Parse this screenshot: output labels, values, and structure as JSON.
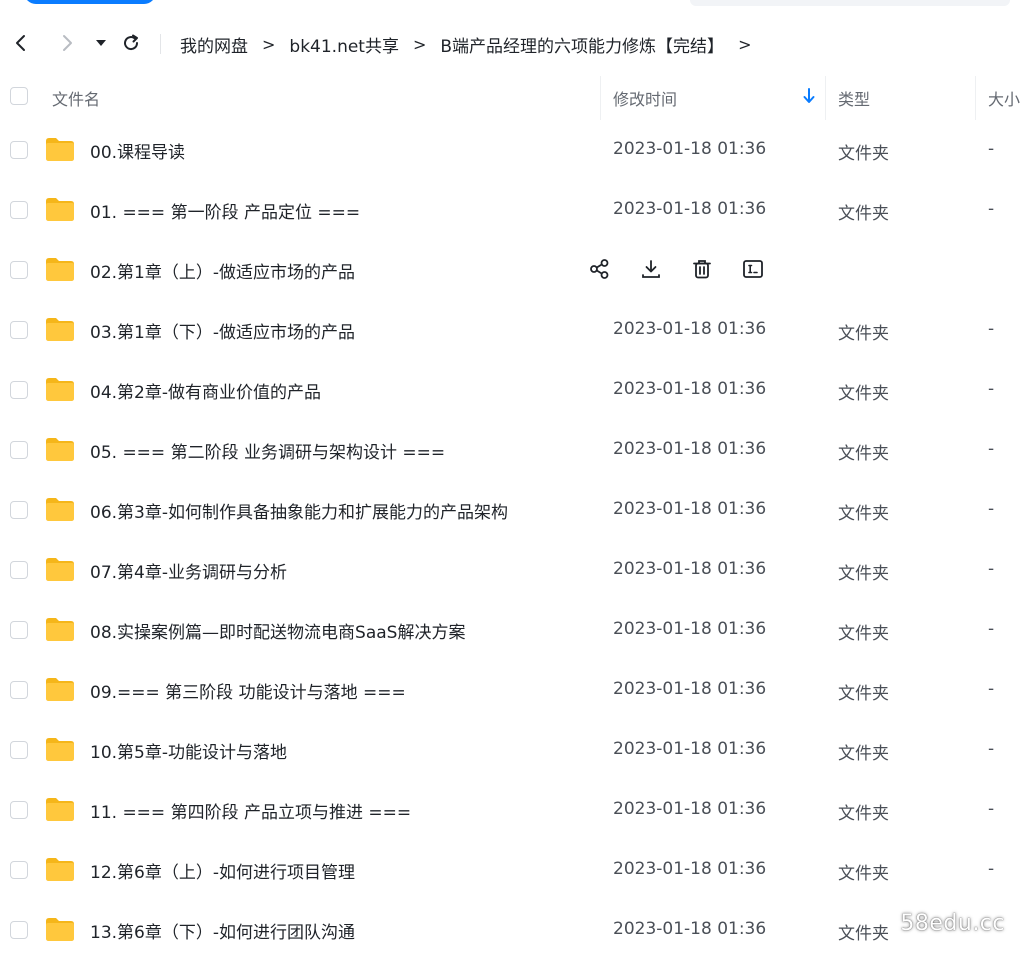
{
  "breadcrumb": [
    "我的网盘",
    "bk41.net共享",
    "B端产品经理的六项能力修炼【完结】"
  ],
  "columns": {
    "name": "文件名",
    "modified": "修改时间",
    "type": "类型",
    "size": "大小"
  },
  "files": [
    {
      "name": "00.课程导读",
      "modified": "2023-01-18 01:36",
      "type": "文件夹",
      "size": "-"
    },
    {
      "name": "01. === 第一阶段 产品定位 ===",
      "modified": "2023-01-18 01:36",
      "type": "文件夹",
      "size": "-"
    },
    {
      "name": "02.第1章（上）-做适应市场的产品",
      "modified": "",
      "type": "",
      "size": "",
      "hovered": true
    },
    {
      "name": "03.第1章（下）-做适应市场的产品",
      "modified": "2023-01-18 01:36",
      "type": "文件夹",
      "size": "-"
    },
    {
      "name": "04.第2章-做有商业价值的产品",
      "modified": "2023-01-18 01:36",
      "type": "文件夹",
      "size": "-"
    },
    {
      "name": "05. === 第二阶段 业务调研与架构设计 ===",
      "modified": "2023-01-18 01:36",
      "type": "文件夹",
      "size": "-"
    },
    {
      "name": "06.第3章-如何制作具备抽象能力和扩展能力的产品架构",
      "modified": "2023-01-18 01:36",
      "type": "文件夹",
      "size": "-"
    },
    {
      "name": "07.第4章-业务调研与分析",
      "modified": "2023-01-18 01:36",
      "type": "文件夹",
      "size": "-"
    },
    {
      "name": "08.实操案例篇—即时配送物流电商SaaS解决方案",
      "modified": "2023-01-18 01:36",
      "type": "文件夹",
      "size": "-"
    },
    {
      "name": "09.=== 第三阶段 功能设计与落地 ===",
      "modified": "2023-01-18 01:36",
      "type": "文件夹",
      "size": "-"
    },
    {
      "name": "10.第5章-功能设计与落地",
      "modified": "2023-01-18 01:36",
      "type": "文件夹",
      "size": "-"
    },
    {
      "name": "11. === 第四阶段 产品立项与推进 ===",
      "modified": "2023-01-18 01:36",
      "type": "文件夹",
      "size": "-"
    },
    {
      "name": "12.第6章（上）-如何进行项目管理",
      "modified": "2023-01-18 01:36",
      "type": "文件夹",
      "size": "-"
    },
    {
      "name": "13.第6章（下）-如何进行团队沟通",
      "modified": "2023-01-18 01:36",
      "type": "文件夹",
      "size": ""
    }
  ],
  "row_actions": [
    "share-icon",
    "download-icon",
    "delete-icon",
    "rename-icon"
  ],
  "sort": {
    "column": "modified",
    "direction": "descending"
  },
  "watermark": "58edu.cc",
  "colors": {
    "folder": "#ffc83d",
    "folder_back": "#f5b619",
    "accent": "#0a7cff"
  }
}
